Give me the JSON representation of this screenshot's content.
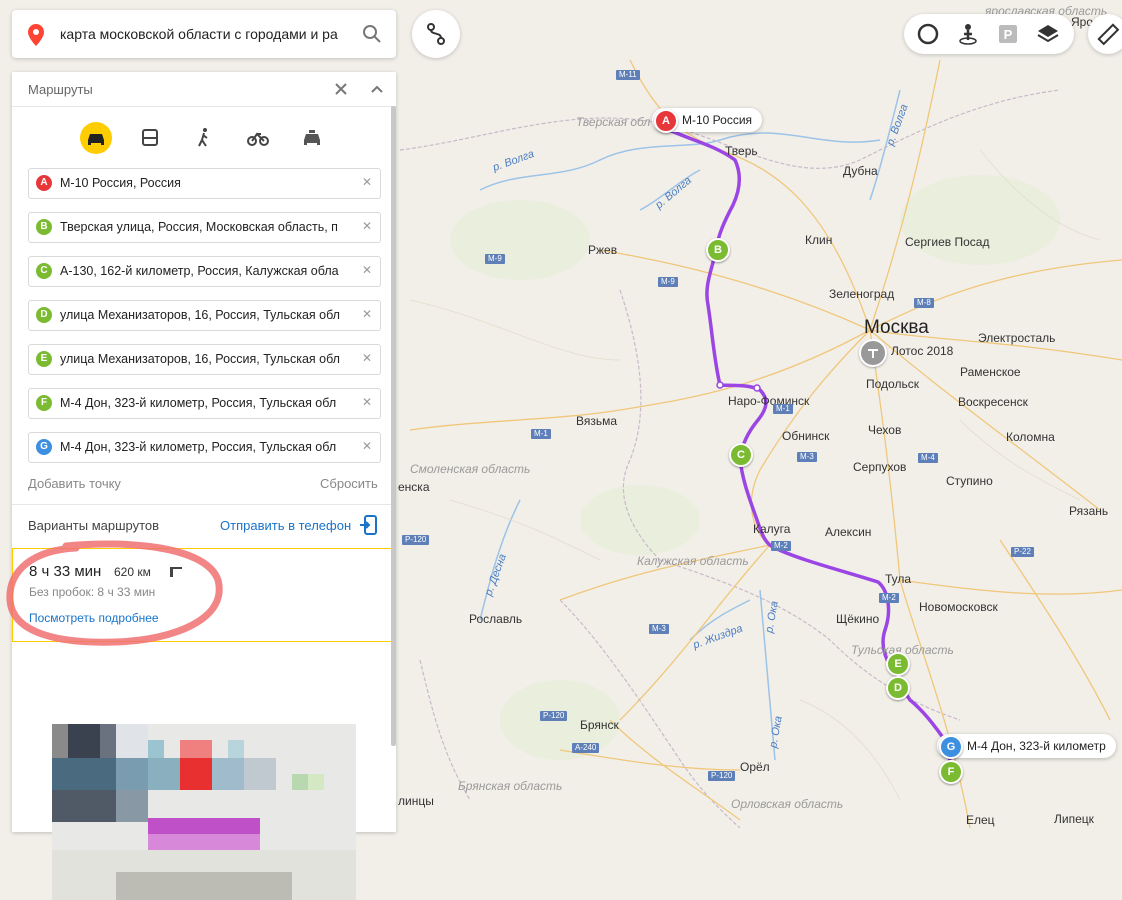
{
  "search": {
    "query": "карта московской области с городами и ра"
  },
  "panel": {
    "title": "Маршруты",
    "waypoints": [
      {
        "letter": "A",
        "text": "М-10 Россия, Россия",
        "color": "#e8373a"
      },
      {
        "letter": "B",
        "text": "Тверская улица, Россия, Московская область, п",
        "color": "#7bbb31"
      },
      {
        "letter": "C",
        "text": "А-130, 162-й километр, Россия, Калужская обла",
        "color": "#7bbb31"
      },
      {
        "letter": "D",
        "text": "улица Механизаторов, 16, Россия, Тульская обл",
        "color": "#7bbb31"
      },
      {
        "letter": "E",
        "text": "улица Механизаторов, 16, Россия, Тульская обл",
        "color": "#7bbb31"
      },
      {
        "letter": "F",
        "text": "М-4 Дон, 323-й километр, Россия, Тульская обл",
        "color": "#7bbb31"
      },
      {
        "letter": "G",
        "text": "М-4 Дон, 323-й километр, Россия, Тульская обл",
        "color": "#3d8fe0"
      }
    ],
    "add_point": "Добавить точку",
    "reset": "Сбросить",
    "variants_title": "Варианты маршрутов",
    "send_to_phone": "Отправить в телефон",
    "route": {
      "time": "8 ч 33 мин",
      "distance": "620 км",
      "no_traffic": "Без пробок: 8 ч 33 мин",
      "more": "Посмотреть подробнее"
    }
  },
  "map": {
    "route_color": "#9b45e4",
    "bubbles": {
      "a": "М-10 Россия",
      "g": "М-4 Дон, 323-й километр"
    },
    "poi": "Лотос 2018",
    "cities": {
      "moscow": "Москва",
      "tver": "Тверь",
      "dubna": "Дубна",
      "rzhev": "Ржев",
      "klin": "Клин",
      "sergiev": "Сергиев Посад",
      "zelenograd": "Зеленоград",
      "elektrostal": "Электросталь",
      "podolsk": "Подольск",
      "ramenskoe": "Раменское",
      "voskresensk": "Воскресенск",
      "naro": "Наро-Фоминск",
      "obninsk": "Обнинск",
      "chekhov": "Чехов",
      "kolomna": "Коломна",
      "vyazma": "Вязьма",
      "serpukhov": "Серпухов",
      "stupino": "Ступино",
      "kaluga": "Калуга",
      "aleksin": "Алексин",
      "ryazan": "Рязань",
      "tula": "Тула",
      "novomoskovsk": "Новомосковск",
      "shchekino": "Щёкино",
      "roslavl": "Рославль",
      "bryansk": "Брянск",
      "orel": "Орёл",
      "yelets": "Елец",
      "lipetsk": "Липецк",
      "enska": "енска",
      "lintsy": "линцы",
      "yar": "Яро"
    },
    "regions": {
      "tver": "Тверская обл",
      "smolensk": "Смоленская область",
      "kaluga": "Калужская область",
      "tula": "Тульская область",
      "bryansk": "Брянская область",
      "orel": "Орловская область",
      "yar": "ярославская область"
    },
    "rivers": {
      "volga1": "р. Волга",
      "volga2": "р. Волга",
      "volga3": "р. Волга",
      "desna": "р. Десна",
      "zhizdra": "р. Жиздра",
      "oka1": "р. Ока",
      "oka2": "р. Ока"
    },
    "roads": {
      "m11": "M-11",
      "m9a": "M-9",
      "m9b": "M-9",
      "m8": "M-8",
      "m1a": "M-1",
      "m1b": "M-1",
      "m3a": "M-3",
      "m3b": "M-3",
      "m4": "M-4",
      "m2a": "M-2",
      "m2b": "M-2",
      "p120a": "P-120",
      "p120b": "P-120",
      "p120c": "P-120",
      "p22": "P-22",
      "a240": "A-240"
    }
  }
}
